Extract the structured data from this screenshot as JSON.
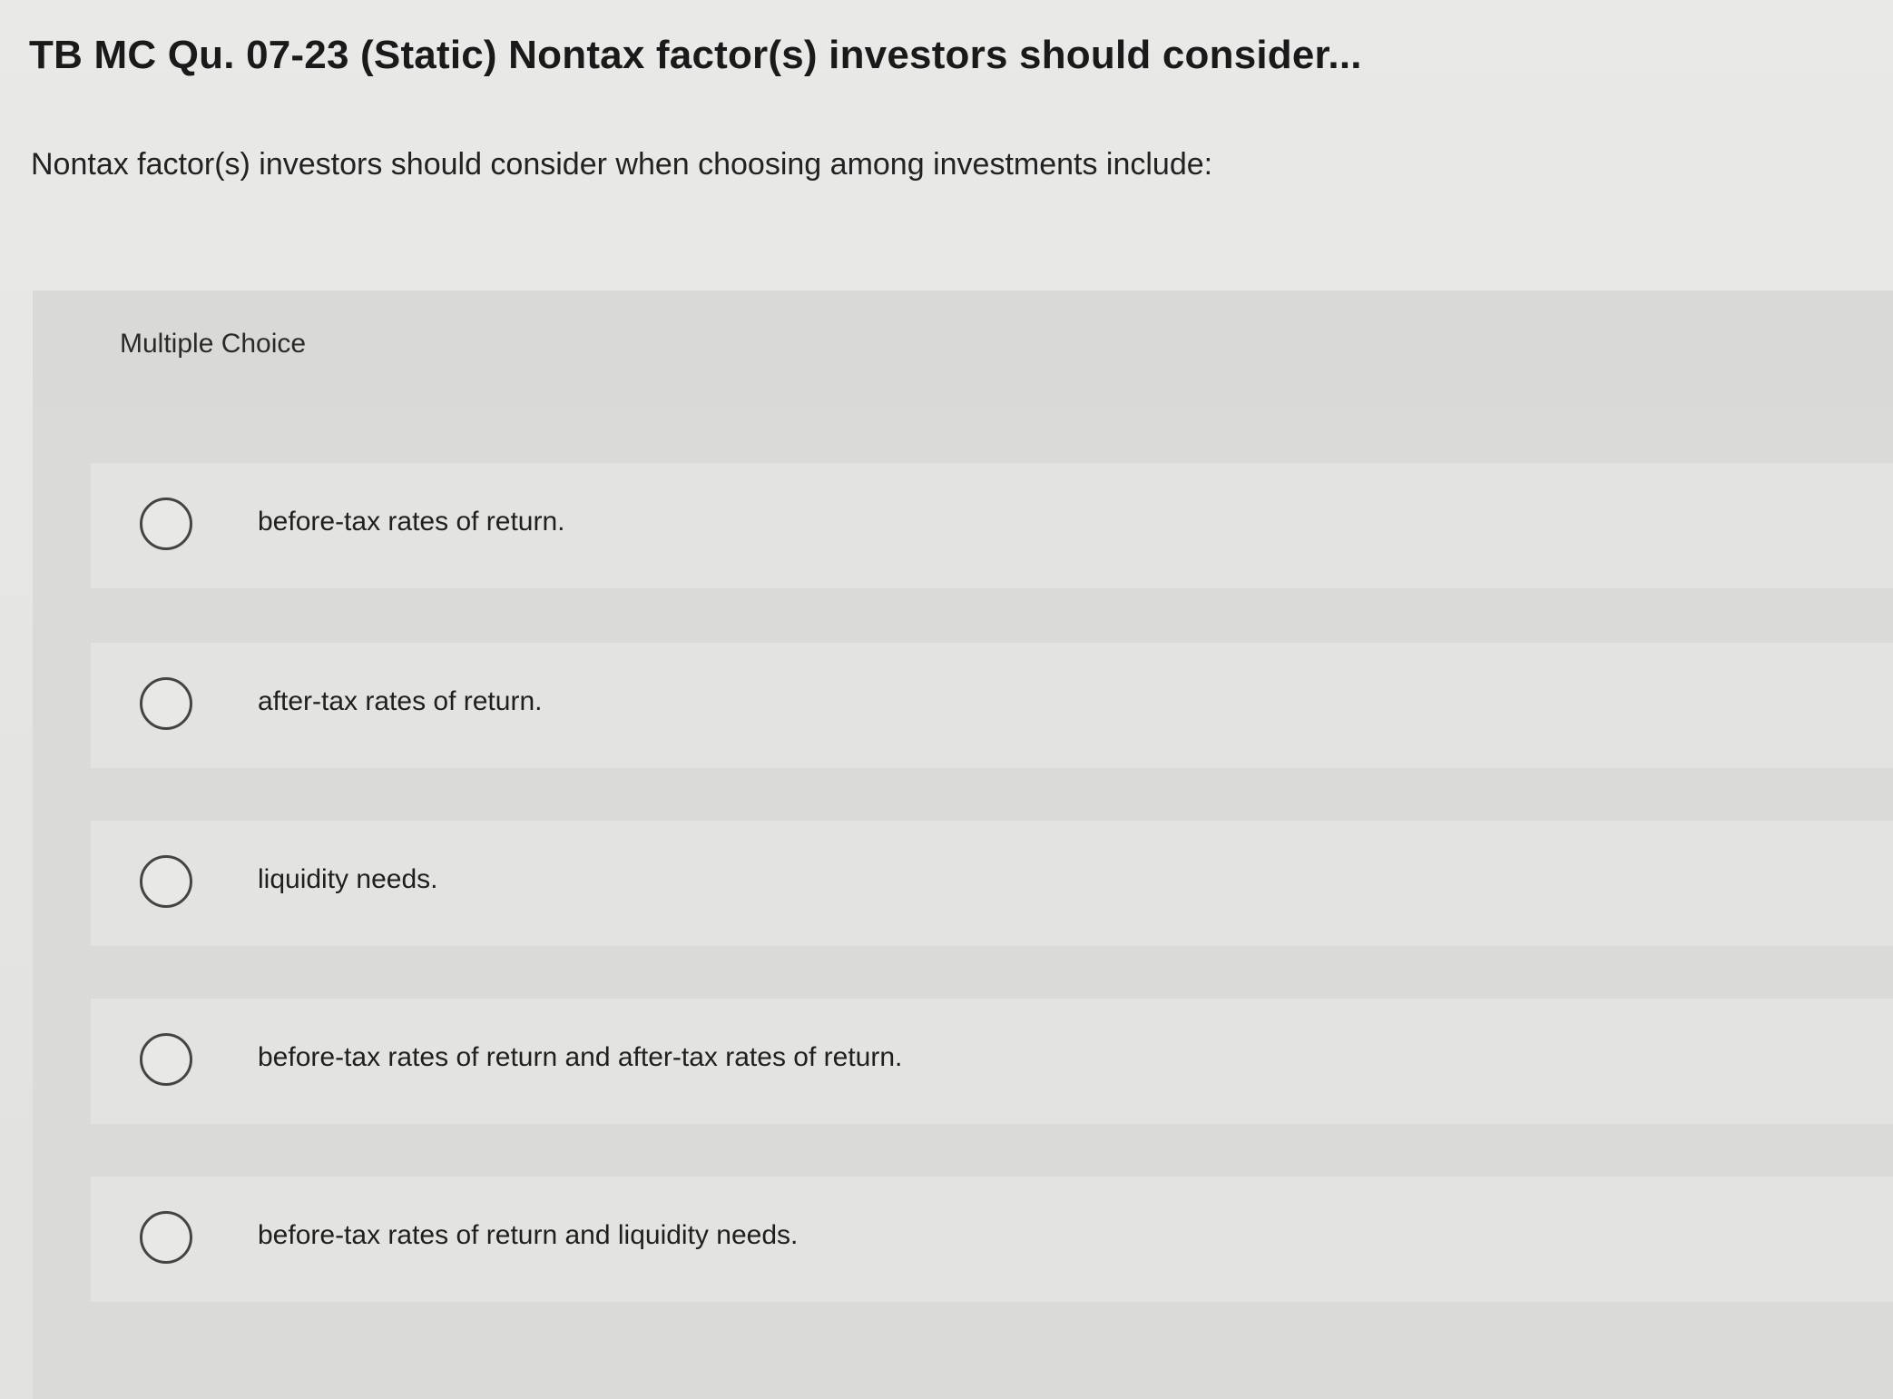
{
  "question": {
    "title": "TB MC Qu. 07-23 (Static) Nontax factor(s) investors should consider...",
    "prompt": "Nontax factor(s) investors should consider when choosing among investments include:"
  },
  "multiple_choice": {
    "label": "Multiple Choice",
    "options": [
      {
        "text": "before-tax rates of return."
      },
      {
        "text": "after-tax rates of return."
      },
      {
        "text": "liquidity needs."
      },
      {
        "text": "before-tax rates of return and after-tax rates of return."
      },
      {
        "text": "before-tax rates of return and liquidity needs."
      }
    ]
  }
}
